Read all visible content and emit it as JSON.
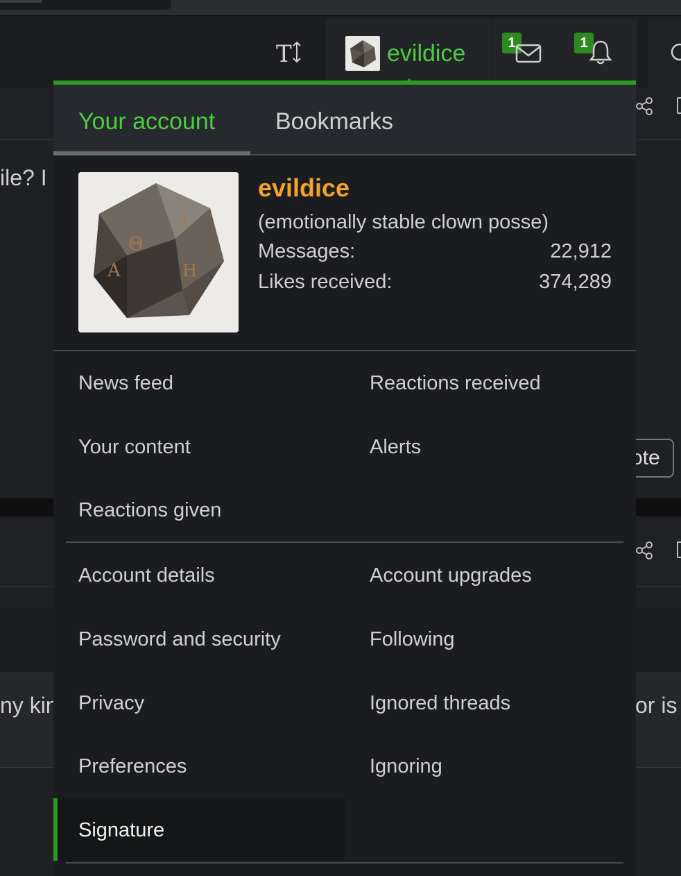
{
  "header": {
    "username": "evildice",
    "inbox_count": "1",
    "alerts_count": "1",
    "text_size_icon": "text-size-icon"
  },
  "background": {
    "snippet1": "ile? I",
    "snippet2": "ny kin",
    "snippet3": "or is",
    "quote_label": "ote"
  },
  "menu": {
    "tabs": [
      {
        "label": "Your account",
        "active": true
      },
      {
        "label": "Bookmarks",
        "active": false
      }
    ],
    "profile": {
      "name": "evildice",
      "title": "(emotionally stable clown posse)",
      "stats": [
        {
          "label": "Messages:",
          "value": "22,912"
        },
        {
          "label": "Likes received:",
          "value": "374,289"
        }
      ]
    },
    "links_group1": [
      "News feed",
      "Reactions received",
      "Your content",
      "Alerts",
      "Reactions given"
    ],
    "links_group2": [
      "Account details",
      "Account upgrades",
      "Password and security",
      "Following",
      "Privacy",
      "Ignored threads",
      "Preferences",
      "Ignoring",
      "Signature"
    ]
  },
  "colors": {
    "accent_green": "#4ccc3f",
    "accent_bar": "#2a9a22",
    "username_orange": "#f3a22a",
    "badge_green": "#2d8a1e"
  }
}
